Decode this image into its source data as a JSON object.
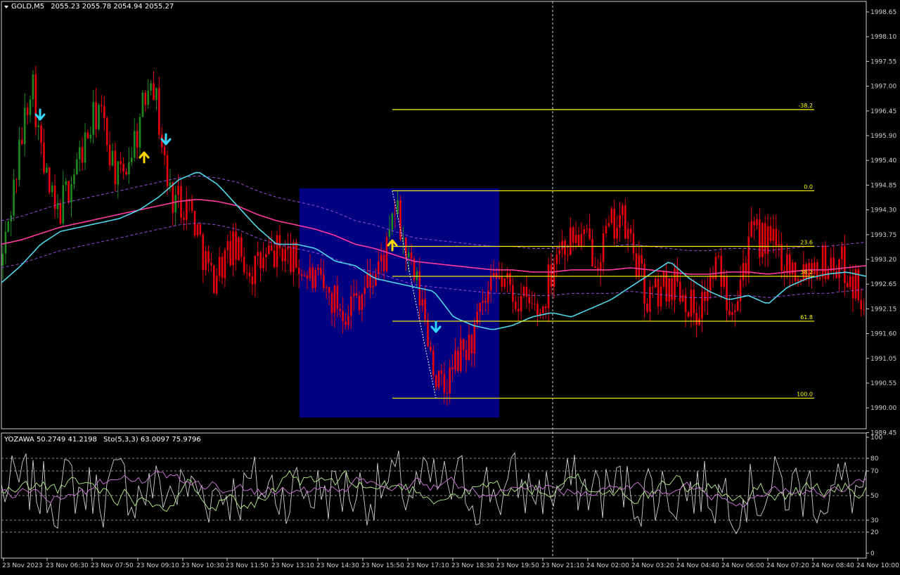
{
  "main_header": {
    "symbol_tf": "GOLD,M5",
    "ohlc": "2055.23 2055.78 2054.94 2055.27"
  },
  "indicator_header": {
    "yozawa": "YOZAWA 50.2749 41.2198",
    "stoch": "Sto(5,3,3) 63.0097 75.9796"
  },
  "colors": {
    "background": "#000000",
    "bear": "#e8000b",
    "bull": "#1f8a1f",
    "fast_ma": "#4fd6e8",
    "slow_ma": "#ff3aa0",
    "envelope": "#9a49d9",
    "fib": "#ffff00",
    "fib_box": "#000080",
    "arrow_up": "#ffd700",
    "arrow_down": "#33d6ff",
    "osc_white": "#cfcfcf",
    "osc_green": "#b6f28b",
    "osc_violet": "#d47ae0",
    "axis": "#cfcfcf"
  },
  "chart_data": {
    "type": "candlestick",
    "symbol": "GOLD",
    "timeframe": "M5",
    "price_axis_ticks": [
      "1998.65",
      "1998.10",
      "1997.55",
      "1997.00",
      "1996.45",
      "1995.90",
      "1995.40",
      "1994.85",
      "1994.30",
      "1993.75",
      "1993.20",
      "1992.65",
      "1992.15",
      "1991.60",
      "1991.05",
      "1990.55",
      "1990.00",
      "1989.45"
    ],
    "price_range": [
      1989.3,
      1999.0
    ],
    "time_axis_labels": [
      "23 Nov 2023",
      "23 Nov 06:30",
      "23 Nov 07:50",
      "23 Nov 09:10",
      "23 Nov 10:30",
      "23 Nov 11:50",
      "23 Nov 13:10",
      "23 Nov 14:30",
      "23 Nov 15:50",
      "23 Nov 17:10",
      "23 Nov 18:30",
      "23 Nov 19:50",
      "23 Nov 21:10",
      "24 Nov 02:00",
      "24 Nov 03:20",
      "24 Nov 04:40",
      "24 Nov 06:00",
      "24 Nov 07:20",
      "24 Nov 08:40",
      "24 Nov 10:00"
    ],
    "fibonacci": {
      "levels": [
        {
          "label": "-38.2",
          "price": 1996.75
        },
        {
          "label": "0.0",
          "price": 1994.85
        },
        {
          "label": "23.6",
          "price": 1993.55
        },
        {
          "label": "38.2",
          "price": 1992.85
        },
        {
          "label": "61.8",
          "price": 1991.8
        },
        {
          "label": "100.0",
          "price": 1990.0
        }
      ]
    },
    "oscillator": {
      "axis_ticks": [
        "100",
        "80",
        "70",
        "50",
        "30",
        "20",
        "0"
      ],
      "range": [
        0,
        100
      ],
      "dashed_levels": [
        80,
        70,
        50,
        30,
        20
      ]
    },
    "fast_ma": [
      1992.7,
      1993.1,
      1993.6,
      1993.9,
      1994.0,
      1994.1,
      1994.2,
      1994.4,
      1994.7,
      1995.1,
      1995.3,
      1995.0,
      1994.5,
      1994.0,
      1993.6,
      1993.6,
      1993.5,
      1993.2,
      1993.1,
      1992.8,
      1992.7,
      1992.6,
      1992.5,
      1991.9,
      1991.7,
      1991.6,
      1991.7,
      1991.9,
      1992.0,
      1991.9,
      1992.1,
      1992.3,
      1992.6,
      1992.9,
      1993.2,
      1992.8,
      1992.5,
      1992.3,
      1992.4,
      1992.2,
      1992.6,
      1992.8,
      1992.9,
      1992.95,
      1992.85
    ],
    "slow_ma": [
      1993.6,
      1993.7,
      1993.85,
      1994.0,
      1994.1,
      1994.2,
      1994.3,
      1994.4,
      1994.5,
      1994.6,
      1994.65,
      1994.6,
      1994.5,
      1994.3,
      1994.15,
      1994.05,
      1993.95,
      1993.8,
      1993.6,
      1993.5,
      1993.35,
      1993.2,
      1993.15,
      1993.1,
      1993.05,
      1993.0,
      1993.0,
      1992.95,
      1992.95,
      1993.0,
      1993.0,
      1993.0,
      1993.05,
      1993.0,
      1992.95,
      1992.9,
      1992.9,
      1992.95,
      1992.95,
      1992.9,
      1992.95,
      1993.0,
      1993.0,
      1993.05,
      1993.1
    ]
  }
}
